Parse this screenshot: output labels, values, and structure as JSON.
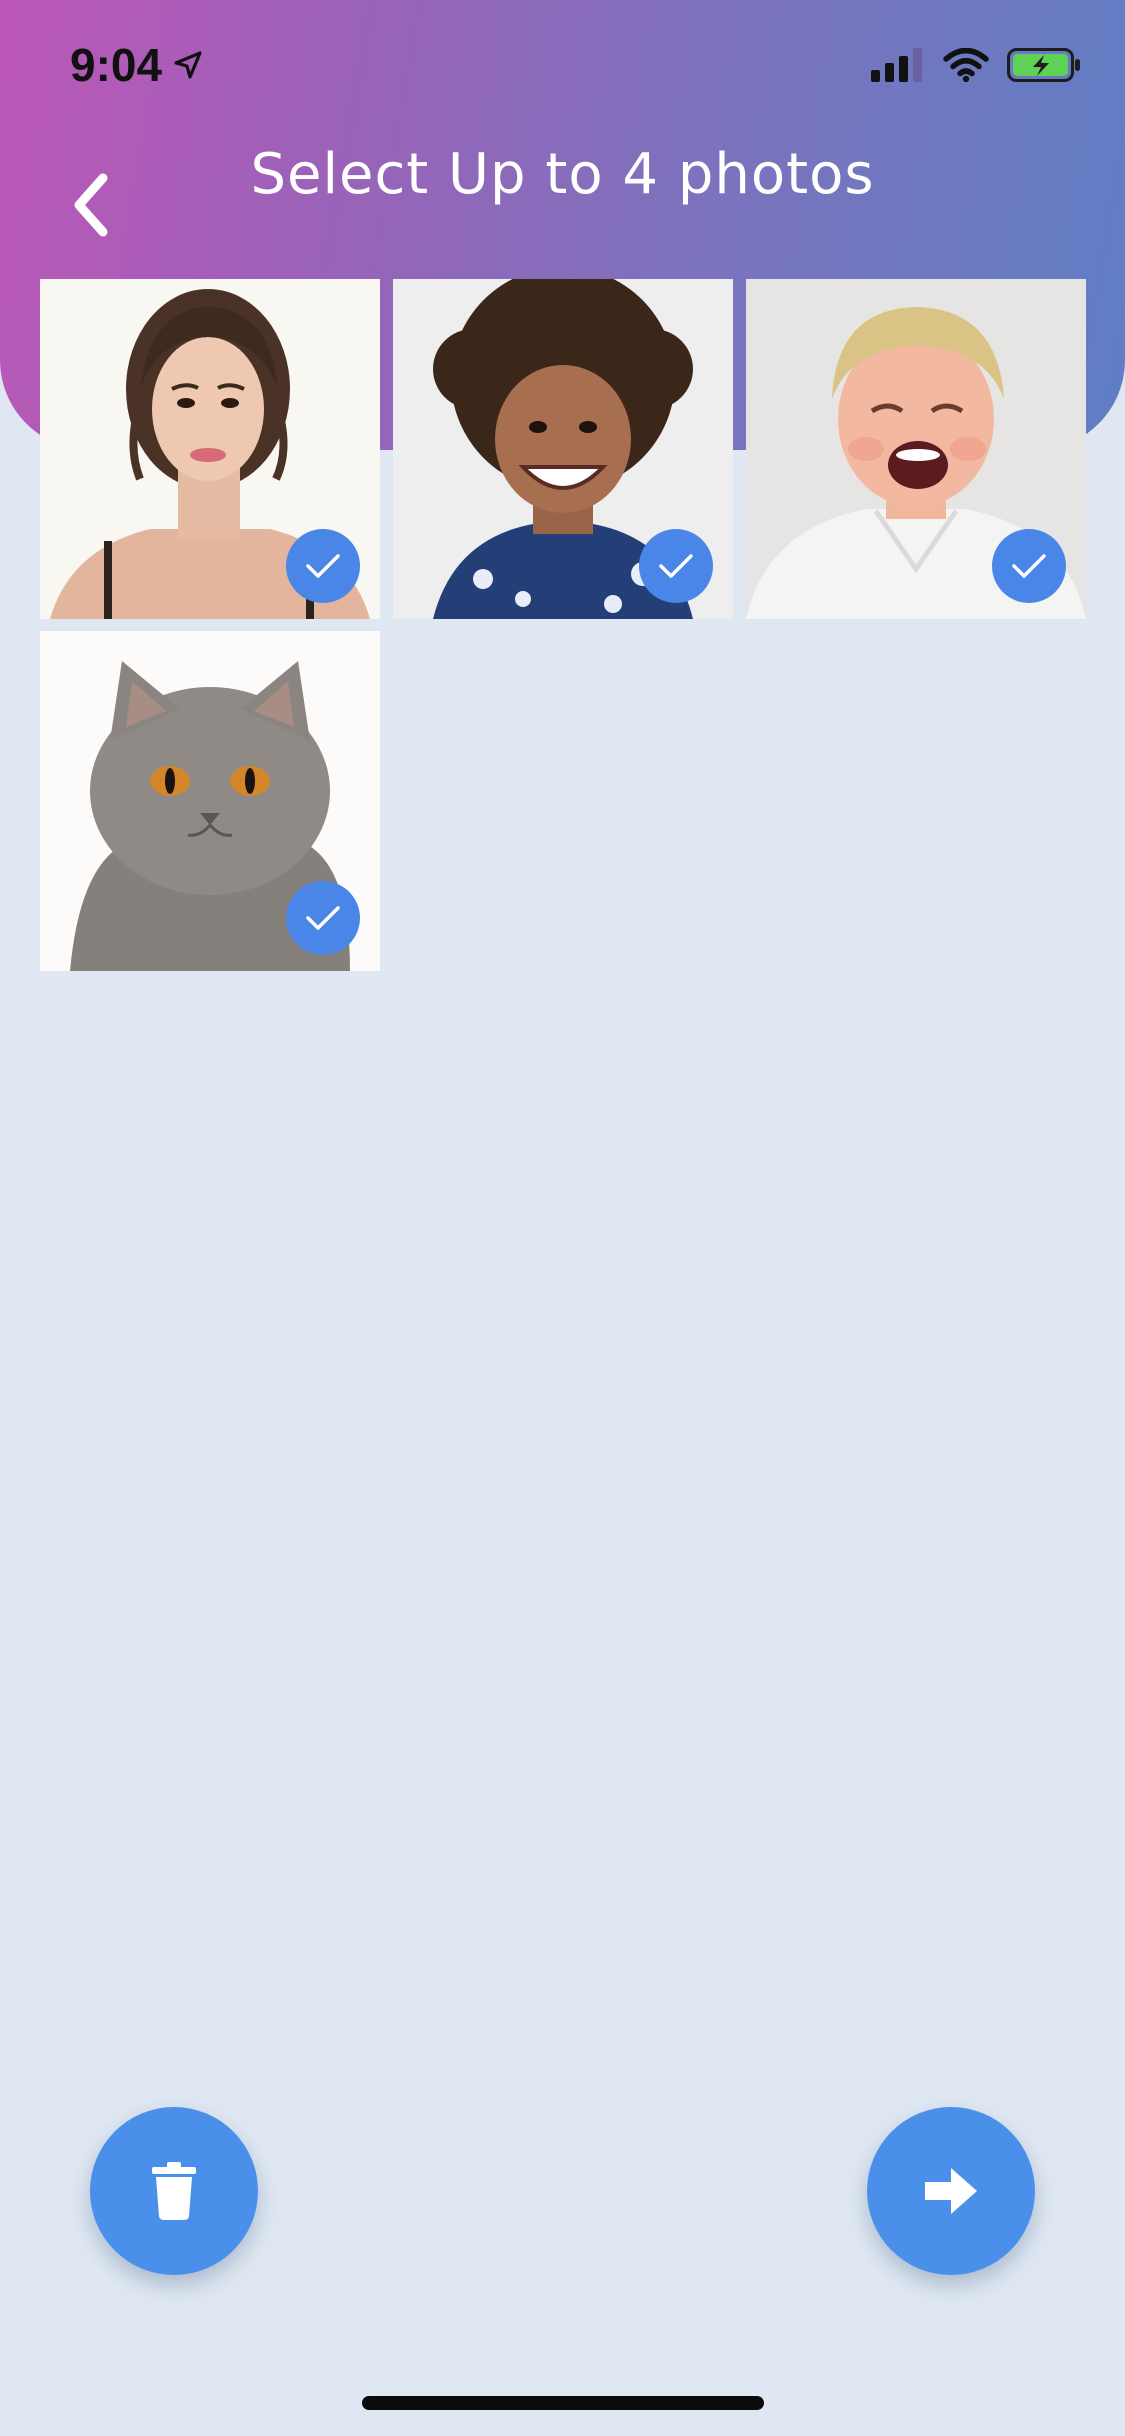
{
  "status_bar": {
    "time": "9:04",
    "icons": [
      "location-arrow-icon",
      "signal-icon",
      "wifi-icon",
      "battery-charging-icon"
    ]
  },
  "header": {
    "title": "Select Up to 4 photos",
    "back_icon": "chevron-left-icon"
  },
  "photos": [
    {
      "subject": "woman-portrait",
      "selected": true,
      "badge_icon": "checkmark-icon"
    },
    {
      "subject": "smiling-boy",
      "selected": true,
      "badge_icon": "checkmark-icon"
    },
    {
      "subject": "crying-child",
      "selected": true,
      "badge_icon": "checkmark-icon"
    },
    {
      "subject": "gray-cat",
      "selected": true,
      "badge_icon": "checkmark-icon"
    }
  ],
  "actions": {
    "delete_icon": "trash-icon",
    "next_icon": "arrow-right-icon"
  },
  "colors": {
    "header_gradient_start": "#bd57b7",
    "header_gradient_end": "#5f7ec4",
    "background": "#dfe8f2",
    "accent": "#4a90ea",
    "badge": "#4a86e8"
  }
}
